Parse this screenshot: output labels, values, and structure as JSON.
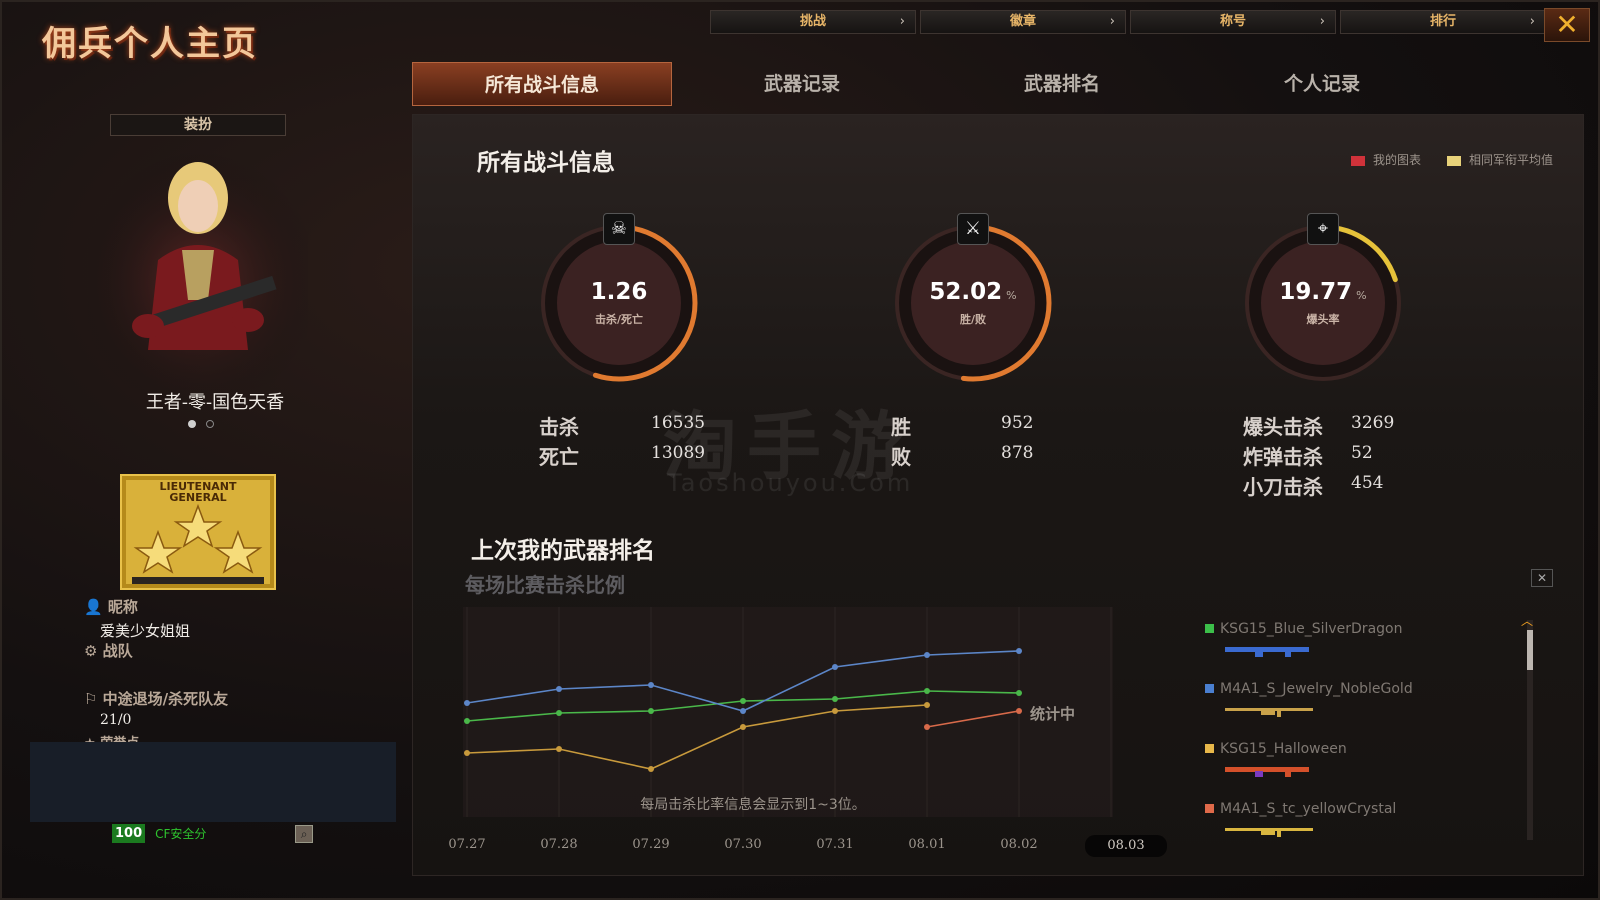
{
  "title": "佣兵个人主页",
  "topnav": [
    {
      "label": "挑战"
    },
    {
      "label": "徽章"
    },
    {
      "label": "称号"
    },
    {
      "label": "排行"
    }
  ],
  "close_label": "✕",
  "tabs": [
    {
      "label": "所有战斗信息",
      "active": true
    },
    {
      "label": "武器记录"
    },
    {
      "label": "武器排名"
    },
    {
      "label": "个人记录"
    }
  ],
  "left": {
    "dressup": "装扮",
    "character_name": "王者-零-国色天香",
    "rank_badge_text": "LIEUTENANT GENERAL",
    "nickname_label": "昵称",
    "nickname": "爱美少女姐姐",
    "team_label": "战队",
    "quit_label": "中途退场/杀死队友",
    "quit_value": "21/0",
    "honor_label": "荣誉点",
    "safe_score": "100",
    "safe_label": "CF安全分"
  },
  "main": {
    "title": "所有战斗信息",
    "legend": [
      {
        "label": "我的图表",
        "color": "#d0323a"
      },
      {
        "label": "相同军衔平均值",
        "color": "#e8d27a"
      }
    ],
    "gauges": [
      {
        "value": "1.26",
        "unit": "",
        "sub": "击杀/死亡",
        "icon": "skull-icon",
        "fill": 0.55
      },
      {
        "value": "52.02",
        "unit": "%",
        "sub": "胜/败",
        "icon": "crossed-guns-icon",
        "fill": 0.52
      },
      {
        "value": "19.77",
        "unit": "%",
        "sub": "爆头率",
        "icon": "rifle-icon",
        "fill": 0.2
      }
    ],
    "stats": {
      "kills_label": "击杀",
      "kills": "16535",
      "deaths_label": "死亡",
      "deaths": "13089",
      "wins_label": "胜",
      "wins": "952",
      "losses_label": "败",
      "losses": "878",
      "headshot_label": "爆头击杀",
      "headshot": "3269",
      "bomb_label": "炸弹击杀",
      "bomb": "52",
      "knife_label": "小刀击杀",
      "knife": "454"
    },
    "watermark": "淘手游",
    "watermark_sub": "Taoshouyou.Com",
    "section2_title": "上次我的武器排名",
    "section2_sub": "每场比赛击杀比例",
    "chart_status": "统计中",
    "chart_note": "每局击杀比率信息会显示到1~3位。",
    "chart_x": [
      "07.27",
      "07.28",
      "07.29",
      "07.30",
      "07.31",
      "08.01",
      "08.02",
      "08.03"
    ],
    "weapons": [
      {
        "name": "KSG15_Blue_SilverDragon",
        "color": "#3cbf4a"
      },
      {
        "name": "M4A1_S_Jewelry_NobleGold",
        "color": "#4a7fd0"
      },
      {
        "name": "KSG15_Halloween",
        "color": "#e8b84a"
      },
      {
        "name": "M4A1_S_tc_yellowCrystal",
        "color": "#e06a4a"
      }
    ]
  },
  "chart_data": {
    "type": "line",
    "x": [
      "07.27",
      "07.28",
      "07.29",
      "07.30",
      "07.31",
      "08.01",
      "08.02"
    ],
    "series": [
      {
        "name": "KSG15_Blue_SilverDragon",
        "color": "#4ab84a",
        "values": [
          0.46,
          0.5,
          0.51,
          0.56,
          0.57,
          0.61,
          0.6
        ]
      },
      {
        "name": "M4A1_S_Jewelry_NobleGold",
        "color": "#5c86c8",
        "values": [
          0.55,
          0.62,
          0.64,
          0.51,
          0.73,
          0.79,
          0.81
        ]
      },
      {
        "name": "KSG15_Halloween",
        "color": "#c89a3c",
        "values": [
          0.3,
          0.32,
          0.22,
          0.43,
          0.51,
          0.54,
          null
        ]
      },
      {
        "name": "M4A1_S_tc_yellowCrystal",
        "color": "#d86a4a",
        "values": [
          null,
          null,
          null,
          null,
          null,
          0.43,
          0.51
        ]
      }
    ],
    "ylim": [
      0,
      1
    ]
  }
}
